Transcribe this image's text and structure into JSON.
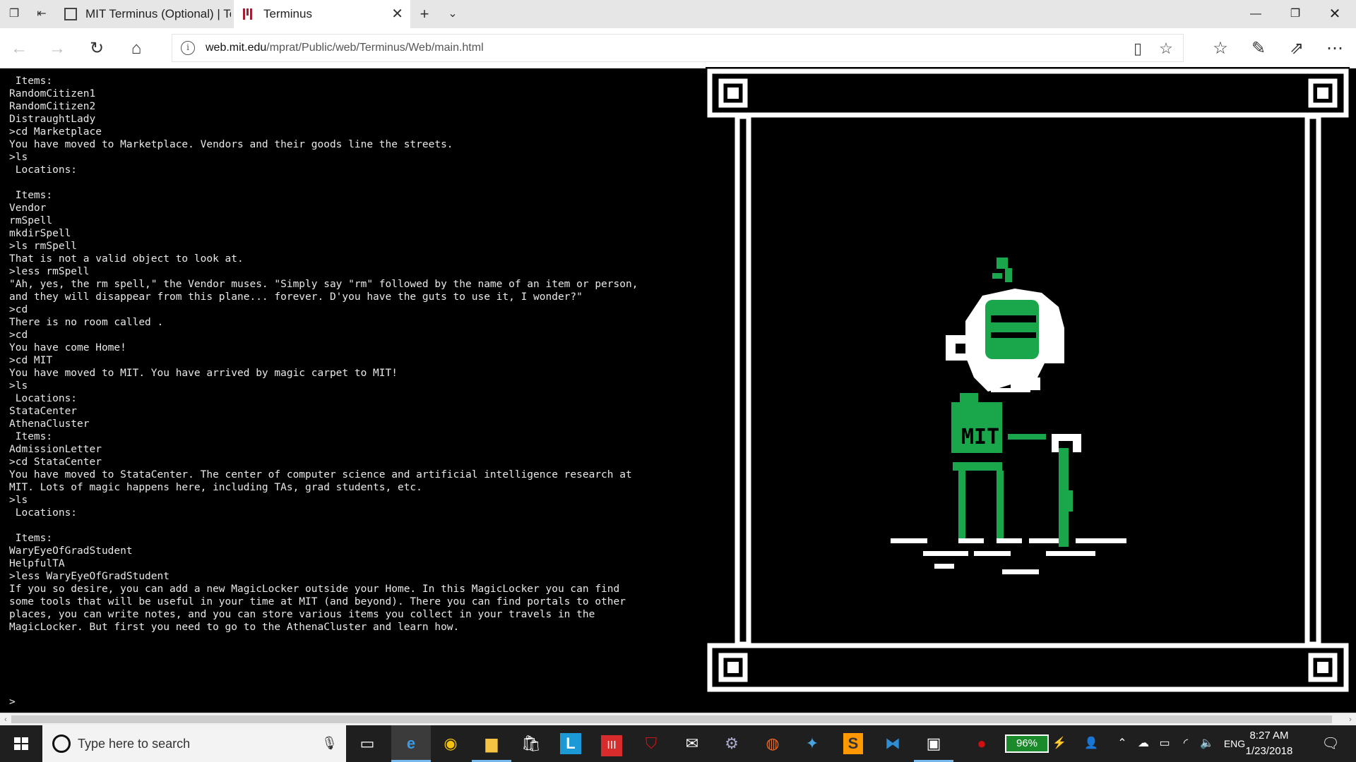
{
  "browser": {
    "tabs": [
      {
        "title": "MIT Terminus (Optional) | Te",
        "active": false
      },
      {
        "title": "Terminus",
        "active": true
      }
    ],
    "url_domain": "web.mit.edu",
    "url_path": "/mprat/Public/web/Terminus/Web/main.html",
    "accent_color": "#a31f34"
  },
  "terminal": {
    "lines": [
      " Items:",
      "RandomCitizen1",
      "RandomCitizen2",
      "DistraughtLady",
      ">cd Marketplace",
      "You have moved to Marketplace. Vendors and their goods line the streets.",
      ">ls",
      " Locations:",
      "",
      " Items:",
      "Vendor",
      "rmSpell",
      "mkdirSpell",
      ">ls rmSpell",
      "That is not a valid object to look at.",
      ">less rmSpell",
      "\"Ah, yes, the rm spell,\" the Vendor muses. \"Simply say \"rm\" followed by the name of an item or person,",
      "and they will disappear from this plane... forever. D'you have the guts to use it, I wonder?\"",
      ">cd",
      "There is no room called .",
      ">cd",
      "You have come Home!",
      ">cd MIT",
      "You have moved to MIT. You have arrived by magic carpet to MIT!",
      ">ls",
      " Locations:",
      "StataCenter",
      "AthenaCluster",
      " Items:",
      "AdmissionLetter",
      ">cd StataCenter",
      "You have moved to StataCenter. The center of computer science and artificial intelligence research at",
      "MIT. Lots of magic happens here, including TAs, grad students, etc.",
      ">ls",
      " Locations:",
      "",
      " Items:",
      "WaryEyeOfGradStudent",
      "HelpfulTA",
      ">less WaryEyeOfGradStudent",
      "If you so desire, you can add a new MagicLocker outside your Home. In this MagicLocker you can find",
      "some tools that will be useful in your time at MIT (and beyond). There you can find portals to other",
      "places, you can write notes, and you can store various items you collect in your travels in the",
      "MagicLocker. But first you need to go to the AthenaCluster and learn how."
    ],
    "prompt": ">"
  },
  "art": {
    "shirt_text": "MIT",
    "fg_color": "#ffffff",
    "green_color": "#1aa64a"
  },
  "taskbar": {
    "search_placeholder": "Type here to search",
    "battery": "96%",
    "language": "ENG",
    "time": "8:27 AM",
    "date": "1/23/2018"
  }
}
